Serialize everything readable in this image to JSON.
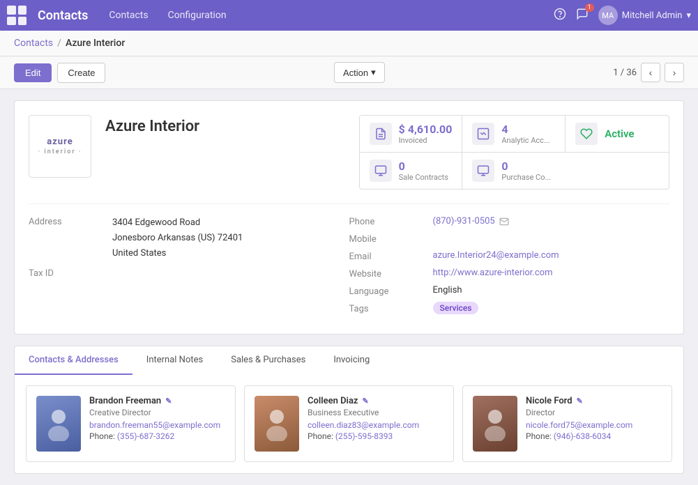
{
  "app": {
    "name": "Contacts",
    "nav_links": [
      "Contacts",
      "Configuration"
    ]
  },
  "topnav": {
    "user_name": "Mitchell Admin",
    "notification_count": "1",
    "help_icon": "?",
    "chat_icon": "💬"
  },
  "breadcrumb": {
    "parent": "Contacts",
    "separator": "/",
    "current": "Azure Interior"
  },
  "toolbar": {
    "edit_label": "Edit",
    "create_label": "Create",
    "action_label": "Action",
    "pagination_text": "1 / 36"
  },
  "contact": {
    "name": "Azure Interior",
    "logo_line1": "azure",
    "logo_line2": "· interior ·"
  },
  "stats": [
    {
      "id": "invoiced",
      "value": "$ 4,610.00",
      "label": "Invoiced",
      "icon": "📄"
    },
    {
      "id": "analytic",
      "value": "4",
      "label": "Analytic Acc...",
      "icon": "📊"
    },
    {
      "id": "active",
      "value": "Active",
      "label": "",
      "icon": "🏷"
    },
    {
      "id": "sale_contracts",
      "value": "0",
      "label": "Sale Contracts",
      "icon": "📋"
    },
    {
      "id": "purchase_contracts",
      "value": "0",
      "label": "Purchase Co...",
      "icon": "📋"
    }
  ],
  "details": {
    "address_label": "Address",
    "address_line1": "3404 Edgewood Road",
    "address_line2": "Jonesboro  Arkansas (US)  72401",
    "address_line3": "United States",
    "tax_id_label": "Tax ID",
    "phone_label": "Phone",
    "phone_value": "(870)-931-0505",
    "mobile_label": "Mobile",
    "email_label": "Email",
    "email_value": "azure.Interior24@example.com",
    "website_label": "Website",
    "website_value": "http://www.azure-interior.com",
    "language_label": "Language",
    "language_value": "English",
    "tags_label": "Tags",
    "tags_value": "Services"
  },
  "tabs": [
    {
      "id": "contacts",
      "label": "Contacts & Addresses",
      "active": true
    },
    {
      "id": "notes",
      "label": "Internal Notes",
      "active": false
    },
    {
      "id": "sales",
      "label": "Sales & Purchases",
      "active": false
    },
    {
      "id": "invoicing",
      "label": "Invoicing",
      "active": false
    }
  ],
  "contacts_list": [
    {
      "name": "Brandon Freeman",
      "title": "Creative Director",
      "email": "brandon.freeman55@example.com",
      "phone": "(355)-687-3262",
      "photo_color": "#6b7fc4"
    },
    {
      "name": "Colleen Diaz",
      "title": "Business Executive",
      "email": "colleen.diaz83@example.com",
      "phone": "(255)-595-8393",
      "photo_color": "#c47a5a"
    },
    {
      "name": "Nicole Ford",
      "title": "Director",
      "email": "nicole.ford75@example.com",
      "phone": "(946)-638-6034",
      "photo_color": "#8b6a5a"
    }
  ]
}
